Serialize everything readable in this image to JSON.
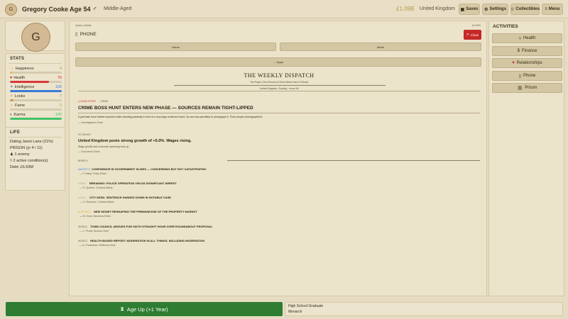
{
  "topbar": {
    "avatar_initial": "G",
    "name": "Gregory Cooke",
    "age": "Age 54",
    "gender_symbol": "♂",
    "life_stage": "Middle-Aged",
    "money": "£1.09B",
    "country": "United Kingdom",
    "buttons": [
      {
        "label": "Saves",
        "icon": "save-icon",
        "glyph": "▣"
      },
      {
        "label": "Settings",
        "icon": "gear-icon",
        "glyph": "⚙"
      },
      {
        "label": "Collectibles",
        "icon": "collectibles-icon",
        "glyph": "♢"
      },
      {
        "label": "Menu",
        "icon": "menu-icon",
        "glyph": "≡"
      }
    ]
  },
  "sidebar": {
    "avatar_initial": "G",
    "stats_title": "STATS",
    "stats": [
      {
        "label": "Happiness",
        "value": "4",
        "fill": 0.04,
        "color": "#e0b63a",
        "val_color": "#b89a3a",
        "glyph": "☺"
      },
      {
        "label": "Health",
        "value": "76",
        "fill": 0.76,
        "color": "#d63a3a",
        "val_color": "#c62828",
        "glyph": "♥"
      },
      {
        "label": "Intelligence",
        "value": "100",
        "fill": 1.0,
        "color": "#3a7ad6",
        "val_color": "#3a7ad6",
        "glyph": "✦"
      },
      {
        "label": "Looks",
        "value": "7",
        "fill": 0.07,
        "color": "#c99650",
        "val_color": "#a87c3a",
        "glyph": "✧"
      },
      {
        "label": "Fame",
        "value": "0",
        "fill": 0.0,
        "color": "#e0c03a",
        "val_color": "#c9a83a",
        "glyph": "☆"
      },
      {
        "label": "Karma",
        "value": "100",
        "fill": 1.0,
        "color": "#44c26a",
        "val_color": "#44c26a",
        "glyph": "◐"
      }
    ],
    "life_title": "LIFE",
    "life_lines": [
      "Dating Janet Lane (21%)",
      "PRISON (yr 4 / 11)",
      "1 enemy",
      "2 active condition(s)",
      "Debt: £6.63M"
    ]
  },
  "main": {
    "breadcrumb": "Quick ▸ Mobile",
    "breadcrumb_right": "A4 90%",
    "title": "PHONE",
    "close_label": "Close",
    "tabs": [
      "Home",
      "Alerts"
    ],
    "apps_label": "← Apps",
    "paper": {
      "name": "THE WEEKLY DISPATCH",
      "tagline": "The Paper (The Record of Short Week Has To Read)",
      "date": "United Kingdom, Sunday · Issue 96",
      "lead_tag": "● LEAD STORY",
      "lead_tag2": "CRIME",
      "lead_headline": "CRIME BOSS HUNT ENTERS NEW PHASE — SOURCES REMAIN TIGHT-LIPPED",
      "lead_body": "A joint task force briefed reporters while standing pointedly in front of a very large evidence board. No one was permitted to photograph it. Three people photographed it.",
      "lead_byline": "— Investigations Team",
      "eco_tag": "ECONOMY",
      "eco_headline": "United Kingdom posts strong growth of +5.0%. Wages rising.",
      "eco_body": "Wage growth and consumer spending both up.",
      "eco_byline": "— Economics Desk",
      "briefly_label": "BRIEFLY",
      "briefs": [
        {
          "tag": "MARKETS",
          "tag_color": "#4a8ad6",
          "headline": "CONFIDENCE IN GOVERNMENT SLIDES — CONCERNING BUT NOT CATASTROPHIC",
          "byline": "— P. Wiley, Policy Editor"
        },
        {
          "tag": "CRIME",
          "tag_color": "#b5a788",
          "headline": "BREAKING: POLICE OPERATION YIELDS SIGNIFICANT ARREST",
          "byline": "— R. Quentin, Criminal Affairs"
        },
        {
          "tag": "LEGAL",
          "tag_color": "#b5a788",
          "headline": "CITY DESK: SENTENCE HANDED DOWN IN NOTABLE CASE",
          "byline": "— S. Okonkwo, Criminal Affairs"
        },
        {
          "tag": "BUSINESS",
          "tag_color": "#d6c03a",
          "headline": "NEW MONEY RESHAPING THE PREMIUM END OF THE PROPERTY MARKET",
          "byline": "— M. Drum, Business Editor"
        },
        {
          "tag": "WORLD",
          "tag_color": "#6a5d46",
          "headline": "TOWN COUNCIL ARGUES FOR SIXTH STRAIGHT HOUR OVER ROUNDABOUT PROPOSAL",
          "byline": "— C. Pruett, Bureau Chief"
        },
        {
          "tag": "WORLD",
          "tag_color": "#6a5d46",
          "headline": "HEALTH BOARD REPORT: MODERATION IN ALL THINGS, INCLUDING MODERATION",
          "byline": "— A. Pradeshan, Wellness Desk"
        }
      ]
    }
  },
  "activities": {
    "title": "ACTIVITIES",
    "items": [
      {
        "label": "Health",
        "icon": "health-icon",
        "glyph": "⚕",
        "glyph_color": "#3a2d18"
      },
      {
        "label": "Finance",
        "icon": "finance-icon",
        "glyph": "$",
        "glyph_color": "#3a2d18"
      },
      {
        "label": "Relationships",
        "icon": "heart-icon",
        "glyph": "♥",
        "glyph_color": "#c62828"
      },
      {
        "label": "Phone",
        "icon": "phone-icon",
        "glyph": "▯",
        "glyph_color": "#3a2d18"
      },
      {
        "label": "Prison",
        "icon": "prison-icon",
        "glyph": "⛓",
        "glyph_color": "#3a2d18"
      }
    ]
  },
  "bottom": {
    "age_up_label": "Age Up (+1 Year)",
    "info_line1": "High School Graduate",
    "info_line2": "Monarch"
  }
}
